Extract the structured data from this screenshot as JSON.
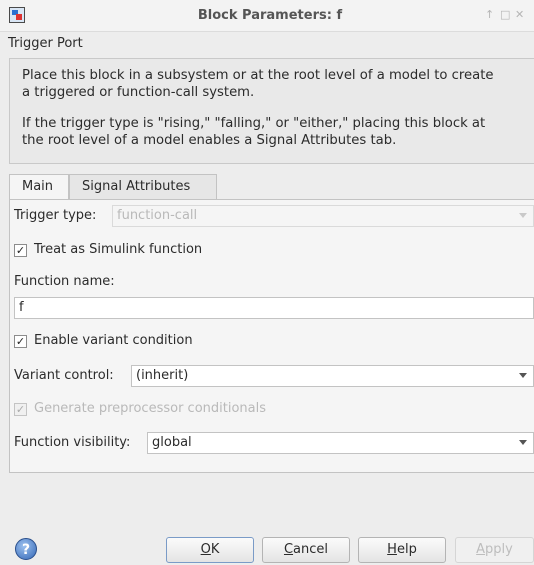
{
  "window": {
    "title": "Block Parameters: f",
    "controls": [
      "↑",
      "□",
      "✕"
    ]
  },
  "block": {
    "name": "Trigger Port"
  },
  "description": {
    "paragraph1_line1": "Place this block in a subsystem or at the root level of a model to create",
    "paragraph1_line2": "a triggered or function-call system.",
    "paragraph2_line1": "If the trigger type is \"rising,\" \"falling,\" or \"either,\" placing this block at",
    "paragraph2_line2": "the root level of a model enables a Signal Attributes tab."
  },
  "tabs": [
    {
      "label": "Main",
      "active": true
    },
    {
      "label": "Signal Attributes",
      "active": false
    }
  ],
  "main": {
    "trigger_type_label": "Trigger type:",
    "trigger_type_value": "function-call",
    "treat_as_simulink_function_label": "Treat as Simulink function",
    "treat_as_simulink_function_checked": "✓",
    "function_name_label": "Function name:",
    "function_name_value": "f",
    "enable_variant_condition_label": "Enable variant condition",
    "enable_variant_condition_checked": "✓",
    "variant_control_label": "Variant control:",
    "variant_control_value": "(inherit)",
    "generate_preprocessor_label": "Generate preprocessor conditionals",
    "generate_preprocessor_checked": "✓",
    "function_visibility_label": "Function visibility:",
    "function_visibility_value": "global"
  },
  "buttons": {
    "help_icon": "?",
    "ok_mnemonic": "O",
    "ok_rest": "K",
    "cancel_mnemonic": "C",
    "cancel_rest": "ancel",
    "help_mnemonic": "H",
    "help_rest": "elp",
    "apply_mnemonic": "A",
    "apply_rest": "pply"
  },
  "colors": {
    "background": "#ededed",
    "panel": "#f5f5f5",
    "disabled_text": "#b9b9b9",
    "help_icon_blue": "#3467b6"
  }
}
